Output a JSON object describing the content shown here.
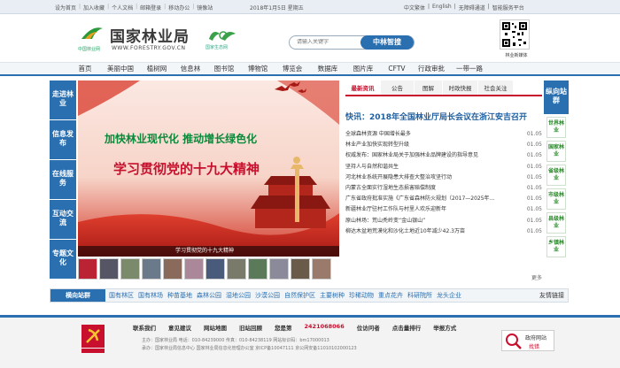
{
  "topbar": {
    "left_links": [
      "设为首页",
      "加入收藏",
      "个人文档",
      "邮箱登录",
      "移动办公",
      "镜像站"
    ],
    "date_text": "2018年1月5日 星期五",
    "right_links": [
      "中文繁体",
      "English",
      "无障碍通道",
      "智能服务平台"
    ]
  },
  "header": {
    "logo_title": "国家林业局",
    "logo_url": "WWW.FORESTRY.GOV.CN",
    "logo_sub": "中国林业网",
    "eco_label": "国家生态网",
    "search_placeholder": "请输入关键字",
    "search_button": "中林智搜",
    "qr_label": "林业新媒体"
  },
  "nav": {
    "items": [
      "首页",
      "美丽中国",
      "植树网",
      "信息林",
      "图书馆",
      "博物馆",
      "博览会",
      "数据库",
      "图片库",
      "CFTV",
      "行政审批",
      "一带一路"
    ]
  },
  "left_column": {
    "items": [
      "走进林业",
      "信息发布",
      "在线服务",
      "互动交流",
      "专题文化"
    ]
  },
  "hero": {
    "slogan1": "加快林业现代化 推动增长绿色化",
    "slogan2": "学习贯彻党的十九大精神",
    "caption": "学习贯彻党的十九大精神"
  },
  "news": {
    "tabs": [
      "最新资讯",
      "公告",
      "图解",
      "时政快报",
      "社会关注"
    ],
    "headline": "快讯：2018年全国林业厅局长会议在浙江安吉召开",
    "items": [
      {
        "title": "全球森林资源 中国增长最多",
        "date": "01.05"
      },
      {
        "title": "林业产业加快实现转型升级",
        "date": "01.05"
      },
      {
        "title": "权威发布：国家林业局关于加强林业品牌建设的指导意见",
        "date": "01.05"
      },
      {
        "title": "坚持人与自然和谐共生",
        "date": "01.05"
      },
      {
        "title": "河北林业系统开展隐患大排查大整治攻坚行动",
        "date": "01.05"
      },
      {
        "title": "内蒙古全面实行湿地生态损害赔偿制度",
        "date": "01.05"
      },
      {
        "title": "广东省政府批准实施《广东省森林防火规划（2017—2025年…",
        "date": "01.05"
      },
      {
        "title": "新疆林业厅驻村工作队与村里人欢乐迎新年",
        "date": "01.05"
      },
      {
        "title": "原山林场：荒山秃岭变“金山银山”",
        "date": "01.05"
      },
      {
        "title": "柳达木盆地荒漠化和沙化土地近10年减少42.3万亩",
        "date": "01.05"
      }
    ],
    "more": "更多"
  },
  "right_column": {
    "head": "纵向站群",
    "items": [
      "世界林业",
      "国家林业",
      "省级林业",
      "市级林业",
      "县级林业",
      "乡镇林业"
    ]
  },
  "link_bar": {
    "label": "横向站群",
    "items": [
      "国有林区",
      "国有林场",
      "种苗基地",
      "森林公园",
      "湿地公园",
      "沙漠公园",
      "自然保护区",
      "主要树种",
      "珍稀动物",
      "重点花卉",
      "科研院所",
      "龙头企业"
    ],
    "right": "友情链接"
  },
  "footer": {
    "links": [
      "联系我们",
      "意见建议",
      "网站地图",
      "旧站回顾",
      "您是第",
      "2421068066",
      "位访问者",
      "点击量排行",
      "举报方式"
    ],
    "line1": "主办：国家林业局 电话：010-84239000 传真：010-84238119 网站标识码：bm17000013",
    "line2": "承办：国家林业局信息中心 国家林业局信息化管理办公室 京ICP备10047111 京公网安备11010102000123",
    "gov1": "政府网站",
    "gov2": "找错"
  },
  "colors": {
    "accent": "#2a6fb0",
    "red": "#c8102e",
    "green": "#2a8a2a"
  }
}
